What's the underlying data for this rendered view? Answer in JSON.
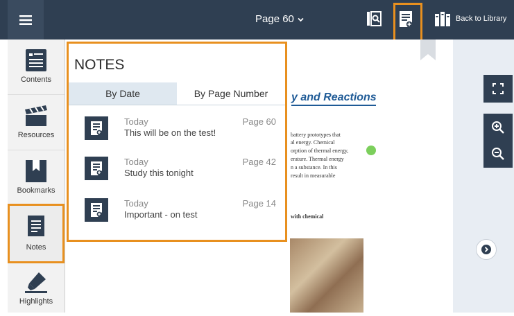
{
  "topbar": {
    "menu_icon": "hamburger-menu-icon",
    "page_indicator": "Page 60",
    "page_dropdown_icon": "chevron-down-icon",
    "search_icon": "search-icon",
    "notes_icon": "notes-icon",
    "library_icon": "library-icon",
    "back_to_library": "Back to Library",
    "bookmark_ribbon_icon": "bookmark-ribbon-icon"
  },
  "sidebar": {
    "items": [
      {
        "label": "Contents",
        "icon": "contents-icon"
      },
      {
        "label": "Resources",
        "icon": "clapperboard-icon"
      },
      {
        "label": "Bookmarks",
        "icon": "bookmarks-icon"
      },
      {
        "label": "Notes",
        "icon": "notes-icon",
        "active": true
      },
      {
        "label": "Highlights",
        "icon": "highlighter-icon"
      }
    ]
  },
  "notes_panel": {
    "title": "NOTES",
    "tabs": [
      {
        "label": "By Date",
        "selected": true
      },
      {
        "label": "By Page Number",
        "selected": false
      }
    ],
    "notes": [
      {
        "date": "Today",
        "page": "Page 60",
        "text": "This will be on the test!",
        "icon": "note-icon"
      },
      {
        "date": "Today",
        "page": "Page 42",
        "text": "Study this tonight",
        "icon": "note-icon"
      },
      {
        "date": "Today",
        "page": "Page 14",
        "text": "Important - on test",
        "icon": "note-icon"
      }
    ]
  },
  "book_page": {
    "heading": "y and Reactions",
    "body_lines": [
      "battery prototypes that",
      "al energy. Chemical",
      "orption of thermal energy,",
      "erature. Thermal energy",
      "n a substance. In this",
      "result in measurable"
    ],
    "caption": "with chemical"
  },
  "right_rail": {
    "fullscreen_icon": "fullscreen-icon",
    "zoom_in_icon": "zoom-in-icon",
    "zoom_out_icon": "zoom-out-icon",
    "next_page_icon": "chevron-right-icon"
  },
  "colors": {
    "topbar": "#2f3f52",
    "highlight": "#e8901f",
    "heading": "#1e5a96",
    "tab_selected": "#dfe8f0"
  }
}
